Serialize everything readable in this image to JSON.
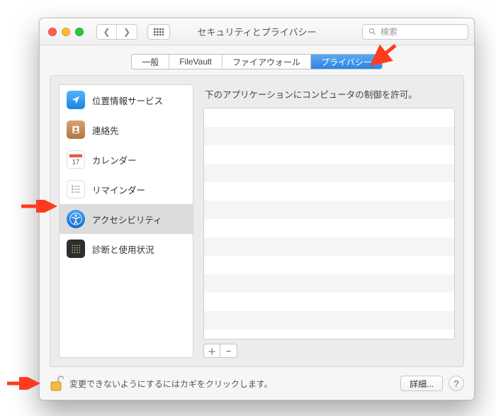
{
  "window": {
    "title": "セキュリティとプライバシー"
  },
  "search": {
    "placeholder": "検索"
  },
  "tabs": [
    {
      "label": "一般",
      "active": false
    },
    {
      "label": "FileVault",
      "active": false
    },
    {
      "label": "ファイアウォール",
      "active": false
    },
    {
      "label": "プライバシー",
      "active": true
    }
  ],
  "sidebar": {
    "items": [
      {
        "label": "位置情報サービス",
        "icon": "location-icon",
        "selected": false
      },
      {
        "label": "連絡先",
        "icon": "contacts-icon",
        "selected": false
      },
      {
        "label": "カレンダー",
        "icon": "calendar-icon",
        "selected": false
      },
      {
        "label": "リマインダー",
        "icon": "reminders-icon",
        "selected": false
      },
      {
        "label": "アクセシビリティ",
        "icon": "accessibility-icon",
        "selected": true
      },
      {
        "label": "診断と使用状況",
        "icon": "diagnostics-icon",
        "selected": false
      }
    ]
  },
  "right": {
    "description": "下のアプリケーションにコンピュータの制御を許可。",
    "add_label": "＋",
    "remove_label": "−"
  },
  "footer": {
    "lock_text": "変更できないようにするにはカギをクリックします。",
    "details_label": "詳細...",
    "help_label": "?"
  }
}
